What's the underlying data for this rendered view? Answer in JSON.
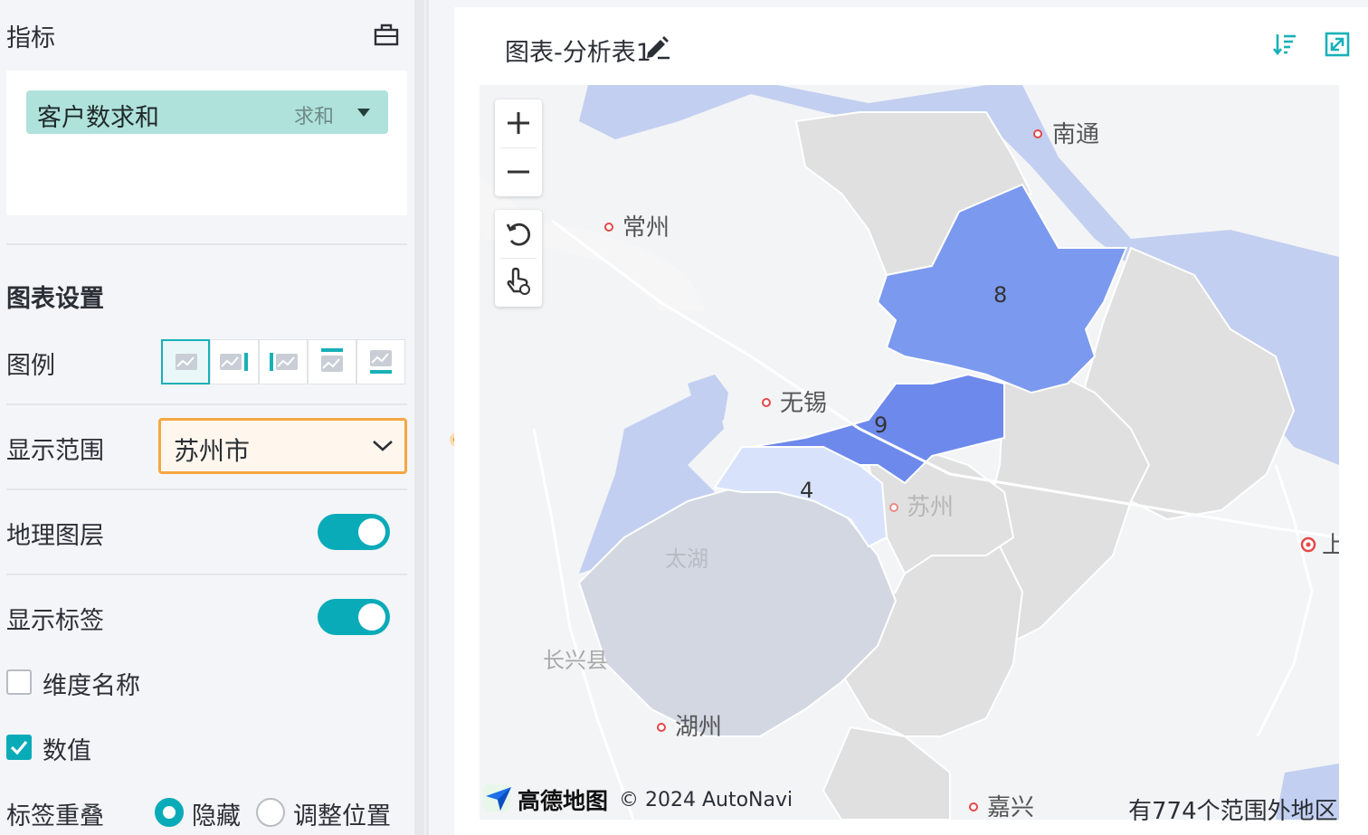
{
  "left_panel": {
    "metrics_title": "指标",
    "metric_chip": {
      "name": "客户数求和",
      "aggregation": "求和"
    },
    "chart_settings_title": "图表设置",
    "legend_label": "图例",
    "legend_options_icon": [
      "legend-none-icon",
      "legend-right-icon",
      "legend-left-icon",
      "legend-top-icon",
      "legend-bottom-icon"
    ],
    "display_range_label": "显示范围",
    "display_range_value": "苏州市",
    "geo_layer_label": "地理图层",
    "geo_layer_on": true,
    "show_labels_label": "显示标签",
    "show_labels_on": true,
    "dimension_name_label": "维度名称",
    "dimension_name_checked": false,
    "value_label": "数值",
    "value_checked": true,
    "label_overlap_label": "标签重叠",
    "overlap_options": [
      "隐藏",
      "调整位置"
    ],
    "overlap_selected": "隐藏"
  },
  "chart": {
    "title": "图表-分析表1",
    "city_labels": [
      "南通",
      "常州",
      "无锡",
      "苏州",
      "湖州",
      "嘉兴",
      "长兴县",
      "太湖",
      "上"
    ],
    "region_values": [
      "8",
      "9",
      "4"
    ],
    "attribution_brand": "高德地图",
    "attribution_copyright": "© 2024 AutoNavi",
    "out_of_range_note": "有774个范围外地区"
  },
  "colors": {
    "accent": "#0aabb8",
    "highlight_border": "#f5a742",
    "chip_bg": "#b0e2dc",
    "region_high": "#6d89ec",
    "region_mid": "#7b99ee",
    "region_low": "#d8e3fb",
    "water": "#c2cff0",
    "land_in_range": "#e0e0e0",
    "arrow": "#ee8a10"
  }
}
